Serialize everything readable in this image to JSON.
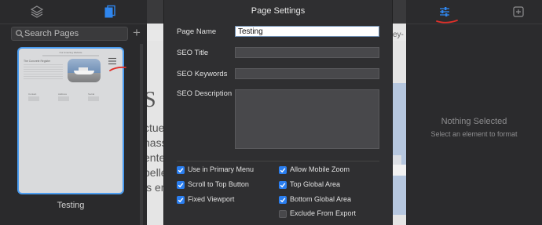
{
  "left": {
    "search_placeholder": "Search Pages",
    "add_label": "+",
    "page_name": "Testing"
  },
  "thumb": {
    "heading": "Our Amazing Website",
    "section_title": "The Concrete Register",
    "col1": "Contact",
    "col2": "Address",
    "col3": "Social"
  },
  "modal": {
    "title": "Page Settings",
    "page_name_label": "Page Name",
    "page_name_value": "Testing",
    "seo_title_label": "SEO Title",
    "seo_title_value": "",
    "seo_keywords_label": "SEO Keywords",
    "seo_keywords_value": "",
    "seo_description_label": "SEO Description",
    "seo_description_value": "",
    "options": {
      "use_in_primary_menu": {
        "label": "Use in Primary Menu",
        "checked": true
      },
      "scroll_to_top": {
        "label": "Scroll to Top Button",
        "checked": true
      },
      "fixed_viewport": {
        "label": "Fixed Viewport",
        "checked": true
      },
      "allow_mobile_zoom": {
        "label": "Allow Mobile Zoom",
        "checked": true
      },
      "top_global_area": {
        "label": "Top Global Area",
        "checked": true
      },
      "bottom_global_area": {
        "label": "Bottom Global Area",
        "checked": true
      },
      "exclude_from_export": {
        "label": "Exclude From Export",
        "checked": false
      }
    }
  },
  "canvas": {
    "url_fragment": "key-",
    "letter": "S",
    "text_lines": [
      "ctuer",
      "nass",
      "entes",
      "pelle",
      "is er"
    ]
  },
  "right": {
    "empty_title": "Nothing Selected",
    "empty_subtitle": "Select an element to format"
  },
  "colors": {
    "accent": "#2a7ef0",
    "annotation_red": "#e0302a"
  }
}
